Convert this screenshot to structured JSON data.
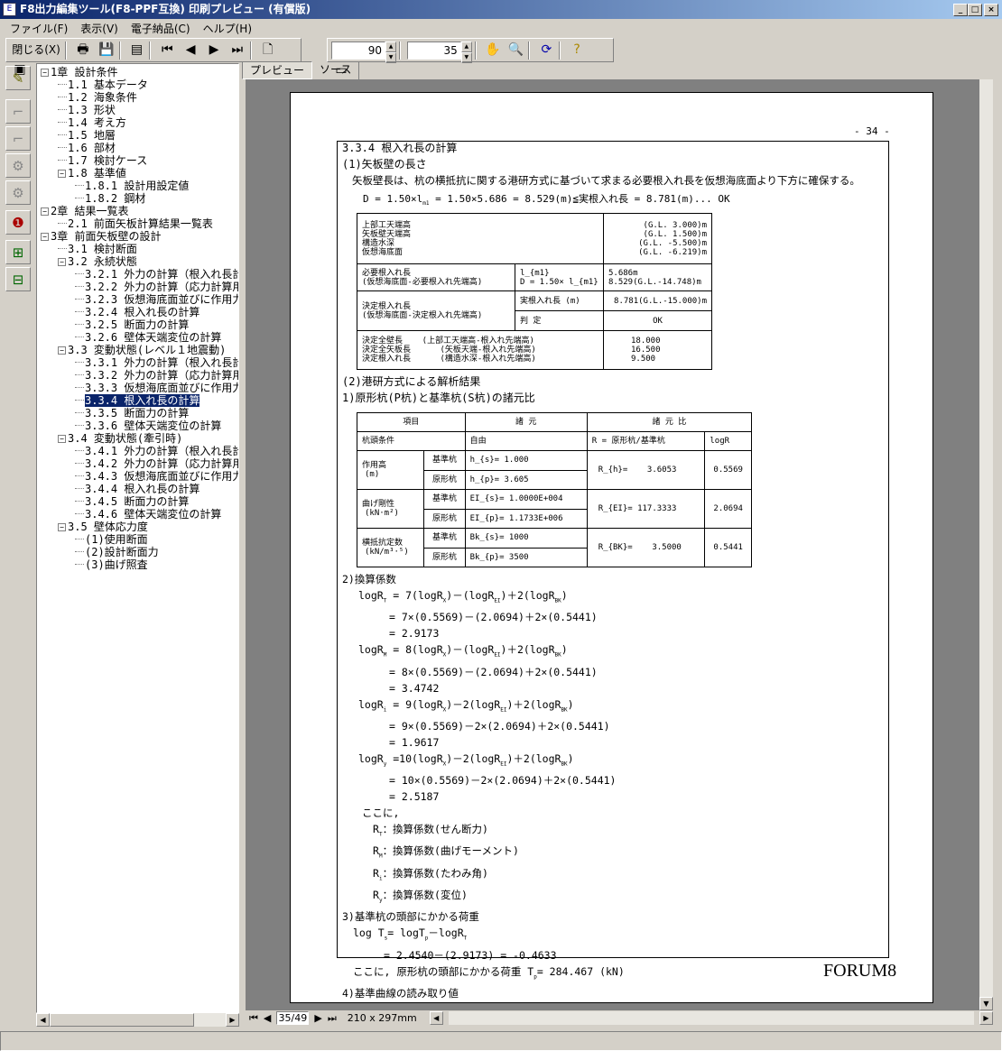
{
  "window": {
    "title": "F8出力編集ツール(F8-PPF互換) 印刷プレビュー (有償版)",
    "app_icon": "document-edit-icon",
    "controls": [
      "_",
      "□",
      "×"
    ]
  },
  "menu": [
    "ファイル(F)",
    "表示(V)",
    "電子納品(C)",
    "ヘルプ(H)"
  ],
  "toolbar": {
    "close_label": "閉じる(X)",
    "zoom_value": "90",
    "page_value": "35"
  },
  "tabs": [
    {
      "label": "プレビュー",
      "active": true
    },
    {
      "label": "ソース",
      "active": false
    }
  ],
  "tree": [
    {
      "level": 0,
      "exp": true,
      "label": "1章 設計条件"
    },
    {
      "level": 1,
      "label": "1.1 基本データ"
    },
    {
      "level": 1,
      "label": "1.2 海象条件"
    },
    {
      "level": 1,
      "label": "1.3 形状"
    },
    {
      "level": 1,
      "label": "1.4 考え方"
    },
    {
      "level": 1,
      "label": "1.5 地層"
    },
    {
      "level": 1,
      "label": "1.6 部材"
    },
    {
      "level": 1,
      "label": "1.7 検討ケース"
    },
    {
      "level": 1,
      "exp": true,
      "label": "1.8 基準値"
    },
    {
      "level": 2,
      "label": "1.8.1 設計用設定値"
    },
    {
      "level": 2,
      "label": "1.8.2 鋼材"
    },
    {
      "level": 0,
      "exp": true,
      "label": "2章 結果一覧表"
    },
    {
      "level": 1,
      "label": "2.1 前面矢板計算結果一覧表"
    },
    {
      "level": 0,
      "exp": true,
      "label": "3章 前面矢板壁の設計"
    },
    {
      "level": 1,
      "label": "3.1 検討断面"
    },
    {
      "level": 1,
      "exp": true,
      "label": "3.2 永続状態"
    },
    {
      "level": 2,
      "label": "3.2.1 外力の計算（根入れ長計"
    },
    {
      "level": 2,
      "label": "3.2.2 外力の計算（応力計算用"
    },
    {
      "level": 2,
      "label": "3.2.3 仮想海底面並びに作用力"
    },
    {
      "level": 2,
      "label": "3.2.4 根入れ長の計算"
    },
    {
      "level": 2,
      "label": "3.2.5 断面力の計算"
    },
    {
      "level": 2,
      "label": "3.2.6 壁体天端変位の計算"
    },
    {
      "level": 1,
      "exp": true,
      "label": "3.3 変動状態(レベル１地震動)"
    },
    {
      "level": 2,
      "label": "3.3.1 外力の計算（根入れ長計"
    },
    {
      "level": 2,
      "label": "3.3.2 外力の計算（応力計算用"
    },
    {
      "level": 2,
      "label": "3.3.3 仮想海底面並びに作用力"
    },
    {
      "level": 2,
      "label": "3.3.4 根入れ長の計算",
      "selected": true
    },
    {
      "level": 2,
      "label": "3.3.5 断面力の計算"
    },
    {
      "level": 2,
      "label": "3.3.6 壁体天端変位の計算"
    },
    {
      "level": 1,
      "exp": true,
      "label": "3.4 変動状態(牽引時)"
    },
    {
      "level": 2,
      "label": "3.4.1 外力の計算（根入れ長計"
    },
    {
      "level": 2,
      "label": "3.4.2 外力の計算（応力計算用"
    },
    {
      "level": 2,
      "label": "3.4.3 仮想海底面並びに作用力"
    },
    {
      "level": 2,
      "label": "3.4.4 根入れ長の計算"
    },
    {
      "level": 2,
      "label": "3.4.5 断面力の計算"
    },
    {
      "level": 2,
      "label": "3.4.6 壁体天端変位の計算"
    },
    {
      "level": 1,
      "exp": true,
      "label": "3.5 壁体応力度"
    },
    {
      "level": 2,
      "label": "(1)使用断面"
    },
    {
      "level": 2,
      "label": "(2)設計断面力"
    },
    {
      "level": 2,
      "label": "(3)曲げ照査"
    }
  ],
  "doc": {
    "page_number": "- 34 -",
    "heading": "3.3.4 根入れ長の計算",
    "sub1": "(1)矢板壁の長さ",
    "para1": "矢板壁長は、杭の横抵抗に関する港研方式に基づいて求まる必要根入れ長を仮想海底面より下方に確保する。",
    "eq1": "D =  1.50×l_{m1}  = 1.50×5.686 = 8.529(m)≦実根入れ長 = 8.781(m)...   OK",
    "table1": {
      "levels_labels": [
        "上部工天端高",
        "矢板壁天端高",
        "構造水深",
        "仮想海底面"
      ],
      "levels_values": [
        "(G.L.   3.000)m",
        "(G.L.   1.500)m",
        "(G.L.  -5.500)m",
        "(G.L.  -6.219)m"
      ],
      "req_label": [
        "必要根入れ長",
        "(仮想海底面-必要根入れ先端高)"
      ],
      "req_formula": [
        "l_{m1}",
        "D = 1.50× l_{m1}"
      ],
      "req_values": [
        "5.686m",
        "8.529(G.L.-14.748)m"
      ],
      "dec_label": [
        "決定根入れ長",
        "(仮想海底面-決定根入れ先端高)"
      ],
      "actual_label": "実根入れ長  (m)",
      "actual_value": "8.781(G.L.-15.000)m",
      "judge_label": "判      定",
      "judge_value": "OK",
      "totals_labels": [
        "決定全壁長    (上部工天端高-根入れ先端高)",
        "決定全矢板長      (矢板天端-根入れ先端高)",
        "決定根入れ長      (構造水深-根入れ先端高)"
      ],
      "totals_values": [
        "18.000",
        "16.500",
        "9.500"
      ]
    },
    "sub2": "(2)港研方式による解析結果",
    "sub2_1": "1)原形杭(P杭)と基準杭(S杭)の諸元比",
    "table2": {
      "headers": [
        "項目",
        "諸 元",
        "諸 元 比"
      ],
      "row_head": [
        "杭頭条件",
        "自由",
        "R = 原形杭/基準杭",
        "logR"
      ],
      "rows": [
        {
          "name": "作用高",
          "unit": "(m)",
          "s": "h_{s}= 1.000",
          "p": "h_{p}= 3.605",
          "ratio": "R_{h}=    3.6053",
          "log": "0.5569"
        },
        {
          "name": "曲げ剛性",
          "unit": "(kN·m²)",
          "s": "EI_{s}= 1.0000E+004",
          "p": "EI_{p}= 1.1733E+006",
          "ratio": "R_{EI}= 117.3333",
          "log": "2.0694"
        },
        {
          "name": "横抵抗定数",
          "unit": "(kN/m³·⁵)",
          "s": "Bk_{s}=   1000",
          "p": "Bk_{p}=   3500",
          "ratio": "R_{BK}=    3.5000",
          "log": "0.5441"
        }
      ],
      "std_label": "基準杭",
      "orig_label": "原形杭"
    },
    "lines": [
      {
        "i": 0,
        "t": "2)換算係数"
      },
      {
        "i": 1,
        "t": "logR_{T} = 7(logR_{X})－(logR_{EI})＋2(logR_{BK})"
      },
      {
        "i": 2,
        "t": "= 7×(0.5569)－(2.0694)＋2×(0.5441)"
      },
      {
        "i": 2,
        "t": "= 2.9173"
      },
      {
        "i": 1,
        "t": "logR_{M} = 8(logR_{X})－(logR_{EI})＋2(logR_{BK})"
      },
      {
        "i": 2,
        "t": "= 8×(0.5569)－(2.0694)＋2×(0.5441)"
      },
      {
        "i": 2,
        "t": "= 3.4742"
      },
      {
        "i": 1,
        "t": "logR_{i} = 9(logR_{X})－2(logR_{EI})＋2(logR_{BK})"
      },
      {
        "i": 2,
        "t": "= 9×(0.5569)－2×(2.0694)＋2×(0.5441)"
      },
      {
        "i": 2,
        "t": "= 1.9617"
      },
      {
        "i": 1,
        "t": "logR_{y} =10(logR_{X})－2(logR_{EI})＋2(logR_{BK})"
      },
      {
        "i": 2,
        "t": "= 10×(0.5569)－2×(2.0694)＋2×(0.5441)"
      },
      {
        "i": 2,
        "t": "= 2.5187"
      },
      {
        "i": 3,
        "t": "ここに,"
      },
      {
        "i": 4,
        "t": "R_{T}：換算係数(せん断力)"
      },
      {
        "i": 4,
        "t": "R_{M}：換算係数(曲げモーメント)"
      },
      {
        "i": 4,
        "t": "R_{i}：換算係数(たわみ角)"
      },
      {
        "i": 4,
        "t": "R_{y}：換算係数(変位)"
      },
      {
        "i": 0,
        "t": "3)基準杭の頭部にかかる荷重"
      },
      {
        "i": 5,
        "t": "log T_{s}= logT_{p}－logR_{T}"
      },
      {
        "i": 6,
        "t": "= 2.4540－(2.9173) = -0.4633"
      },
      {
        "i": 5,
        "t": "ここに, 原形杭の頭部にかかる荷重  T_{p}= 284.467 (kN)"
      },
      {
        "i": 0,
        "t": "4)基準曲線の読み取り値"
      }
    ],
    "footer_logo": "FORUM8"
  },
  "nav": {
    "page_field": "35/49",
    "paper_size": "210 x 297mm"
  }
}
